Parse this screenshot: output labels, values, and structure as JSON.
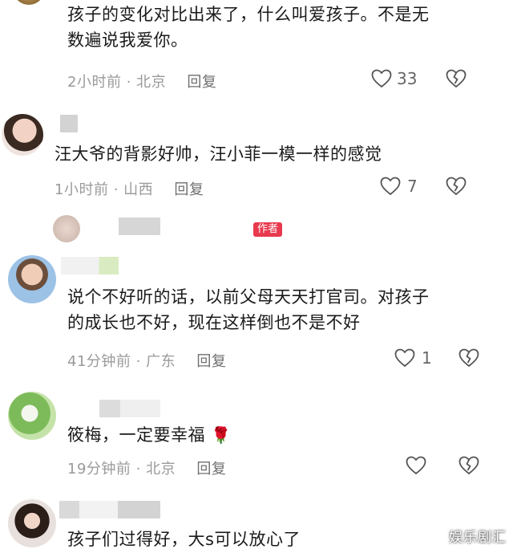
{
  "comments": [
    {
      "text_line1": "孩子的变化对比出来了，什么叫爱孩子。不是无",
      "text_line2": "数遍说我爱你。",
      "time": "2小时前",
      "location": "北京",
      "reply_label": "回复",
      "likes": "33"
    },
    {
      "text_line1": "汪大爷的背影好帅，汪小菲一模一样的感觉",
      "time": "1小时前",
      "location": "山西",
      "reply_label": "回复",
      "likes": "7"
    },
    {
      "author_tag": "作者"
    },
    {
      "text_line1": "说个不好听的话，以前父母天天打官司。对孩子",
      "text_line2": "的成长也不好，现在这样倒也不是不好",
      "time": "41分钟前",
      "location": "广东",
      "reply_label": "回复",
      "likes": "1"
    },
    {
      "text_line1": "筱梅，一定要幸福",
      "emoji": "🌹",
      "time": "19分钟前",
      "location": "北京",
      "reply_label": "回复"
    },
    {
      "text_line1": "孩子们过得好，大s可以放心了"
    }
  ],
  "meta_separator": "·",
  "watermark": "娱乐剧汇",
  "colors": {
    "author_tag": "#e8394f",
    "meta_text": "#9a9a9a",
    "icon": "#555555"
  }
}
